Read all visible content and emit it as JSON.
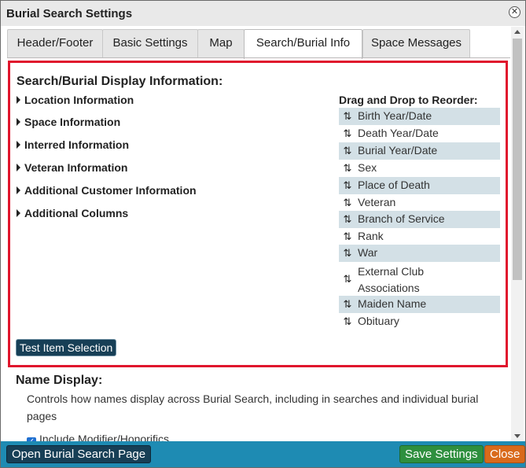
{
  "window": {
    "title": "Burial Search Settings"
  },
  "tabs": [
    {
      "label": "Header/Footer"
    },
    {
      "label": "Basic Settings"
    },
    {
      "label": "Map"
    },
    {
      "label": "Search/Burial Info"
    },
    {
      "label": "Space Messages"
    }
  ],
  "panel": {
    "title": "Search/Burial Display Information:",
    "sections": [
      "Location Information",
      "Space Information",
      "Interred Information",
      "Veteran Information",
      "Additional Customer Information",
      "Additional Columns"
    ],
    "reorder_title": "Drag and Drop to Reorder:",
    "reorder_items": [
      "Birth Year/Date",
      "Death Year/Date",
      "Burial Year/Date",
      "Sex",
      "Place of Death",
      "Veteran",
      "Branch of Service",
      "Rank",
      "War",
      "External Club Associations",
      "Maiden Name",
      "Obituary"
    ],
    "test_button": "Test Item Selection"
  },
  "name_display": {
    "title": "Name Display:",
    "description": "Controls how names display across Burial Search, including in searches and individual burial pages",
    "checkbox_label": "Include Modifier/Honorifics"
  },
  "footer": {
    "open_label": "Open Burial Search Page",
    "save_label": "Save Settings",
    "close_label": "Close"
  },
  "colors": {
    "highlight_border": "#e0152d",
    "footer_bg": "#1e8bb3",
    "save_bg": "#2e8f3e",
    "close_bg": "#d96a1b",
    "dark_button": "#173f56",
    "row_shade": "#d3e0e6"
  },
  "icons": {
    "close": "close-circle-icon",
    "reorder": "up-down-arrows-icon",
    "expand": "caret-right-icon"
  }
}
